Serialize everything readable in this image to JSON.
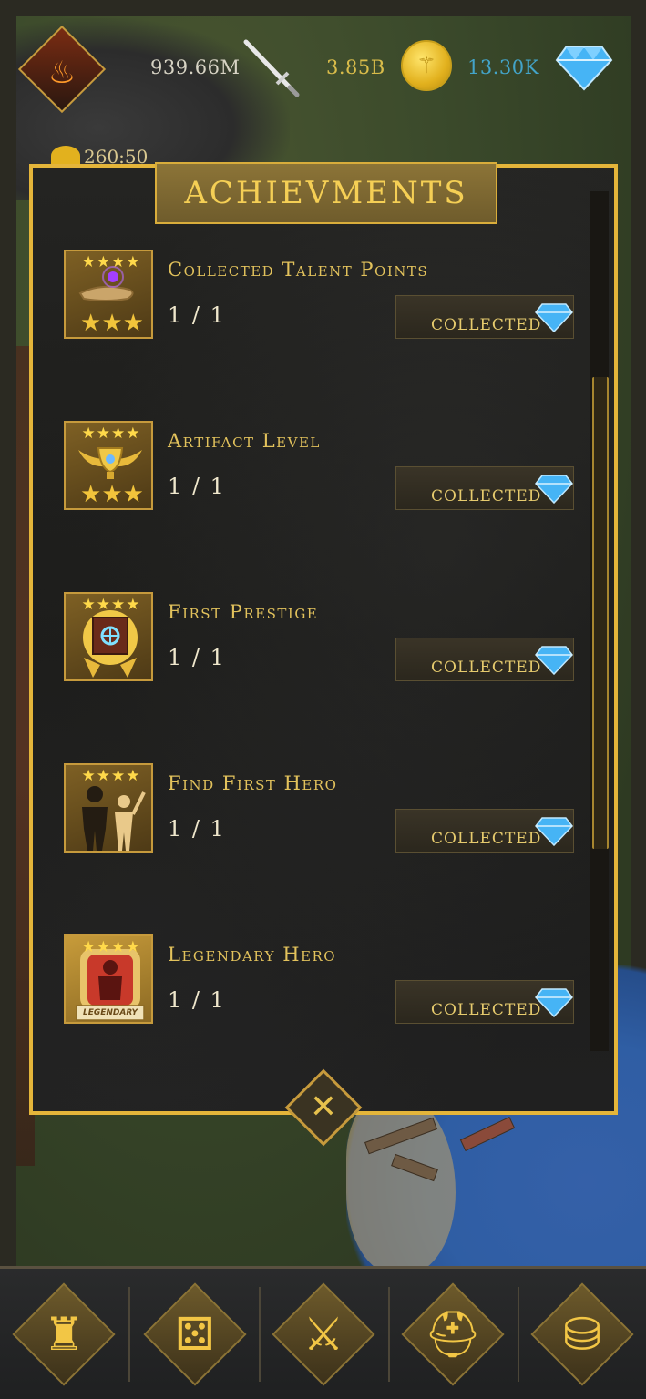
{
  "hud": {
    "damage": "939.66M",
    "gold": "3.85B",
    "gems": "13.30K",
    "timer": "260:50"
  },
  "panel": {
    "title": "ACHIEVMENTS"
  },
  "achievements": [
    {
      "title": "Collected Talent Points",
      "progress": "1 / 1",
      "button": "COLLECTED",
      "icon": "talent-hand-icon"
    },
    {
      "title": "Artifact Level",
      "progress": "1 / 1",
      "button": "COLLECTED",
      "icon": "winged-chalice-icon"
    },
    {
      "title": "First Prestige",
      "progress": "1 / 1",
      "button": "COLLECTED",
      "icon": "prestige-scroll-icon"
    },
    {
      "title": "Find First Hero",
      "progress": "1 / 1",
      "button": "COLLECTED",
      "icon": "heroes-silhouette-icon"
    },
    {
      "title": "Legendary Hero",
      "progress": "1 / 1",
      "button": "COLLECTED",
      "icon": "legendary-hero-icon",
      "badge": "LEGENDARY"
    }
  ],
  "close_label": "✕",
  "nav": [
    {
      "name": "castle",
      "icon": "castle-icon"
    },
    {
      "name": "dice",
      "icon": "dice-icon"
    },
    {
      "name": "battle",
      "icon": "crossed-swords-icon"
    },
    {
      "name": "heroes",
      "icon": "helmet-icon"
    },
    {
      "name": "shop",
      "icon": "coin-stack-icon"
    }
  ],
  "colors": {
    "gold_accent": "#e4b53a",
    "gem_blue": "#43a4c9",
    "panel_bg": "#1c1c1a"
  }
}
